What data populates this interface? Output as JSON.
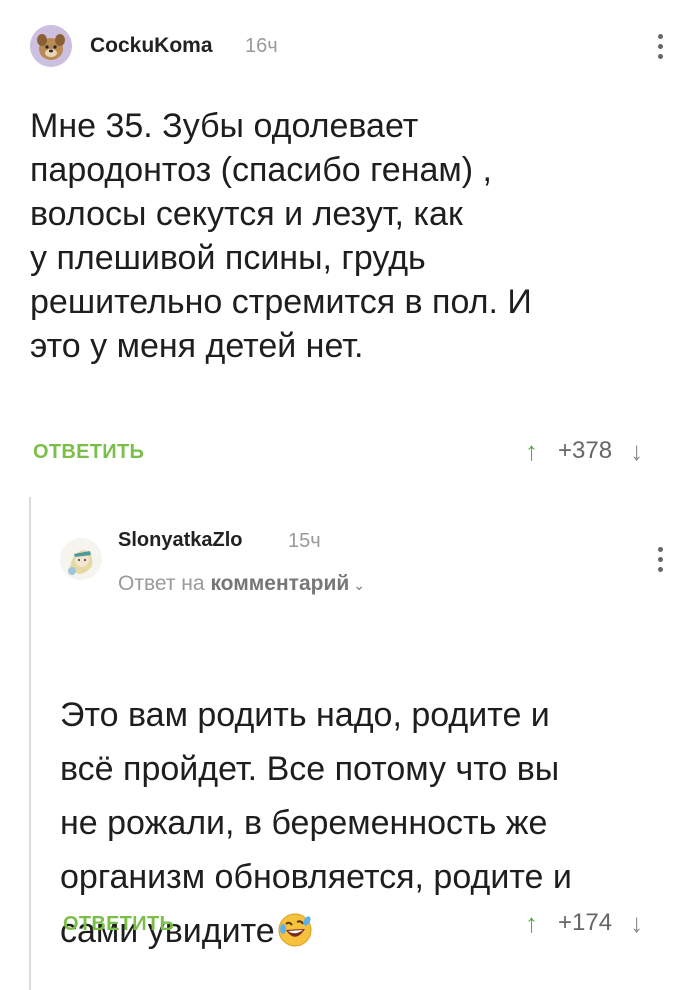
{
  "comments": [
    {
      "username": "CockuKoma",
      "time": "16ч",
      "text": "Мне 35. Зубы одолевает\nпародонтоз (спасибо генам) ,\nволосы секутся и лезут, как\nу плешивой псины, грудь\nрешительно стремится в пол. И\nэто у меня детей нет.",
      "reply_label": "ОТВЕТИТЬ",
      "score": "+378"
    },
    {
      "username": "SlonyatkaZlo",
      "time": "15ч",
      "reply_to_prefix": "Ответ на",
      "reply_to_target": "комментарий",
      "text": "Это вам родить надо, родите и\nвсё пройдет. Все потому что вы\nне рожали, в беременность же\nорганизм обновляется, родите и\nсами увидите",
      "emoji": "rolling-on-floor-laughing",
      "reply_label": "ОТВЕТИТЬ",
      "score": "+174"
    }
  ],
  "colors": {
    "accent_green": "#7bbf4a",
    "upvote_green": "#5fa83b"
  }
}
